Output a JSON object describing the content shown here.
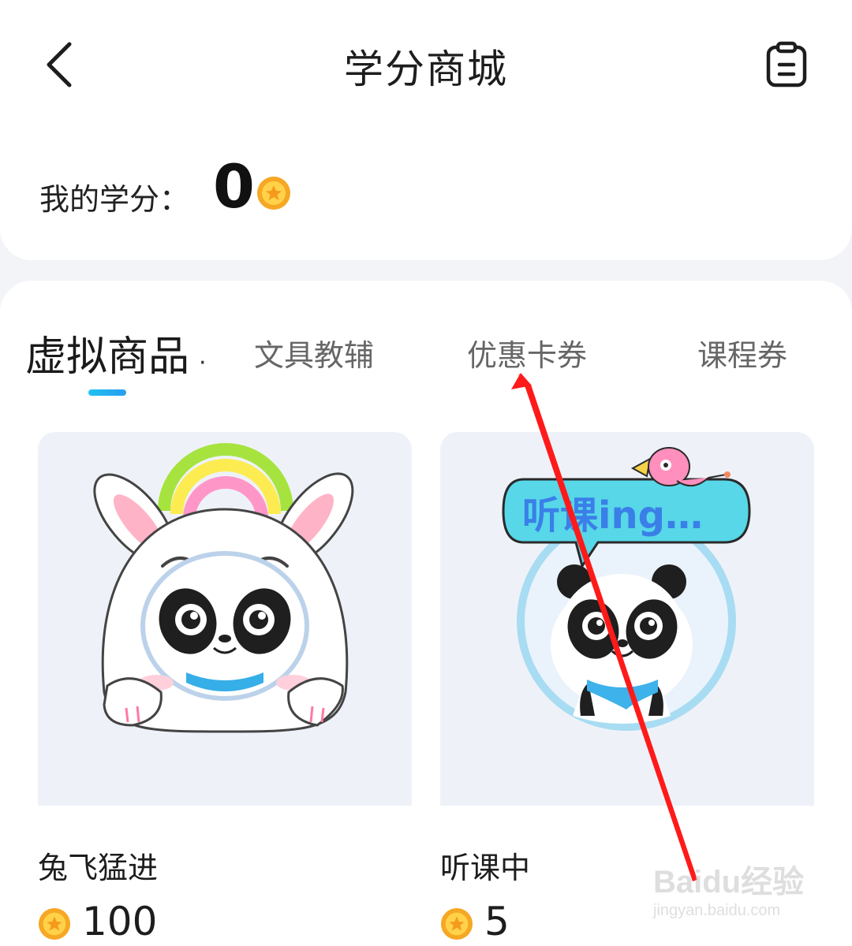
{
  "header": {
    "title": "学分商城",
    "back_icon": "chevron-left-icon",
    "orders_icon": "clipboard-icon"
  },
  "credits": {
    "label": "我的学分：",
    "value": "0",
    "coin_icon": "gold-coin-icon"
  },
  "tabs": [
    {
      "label": "虚拟商品",
      "active": true
    },
    {
      "label": "文具教辅",
      "active": false
    },
    {
      "label": "优惠卡券",
      "active": false
    },
    {
      "label": "课程券",
      "active": false
    }
  ],
  "products": [
    {
      "name": "兔飞猛进",
      "price": "100",
      "image_icon": "bunny-panda-avatar-icon"
    },
    {
      "name": "听课中",
      "price": "5",
      "image_icon": "listening-panda-avatar-icon"
    }
  ],
  "overlay": {
    "annotation": "red-arrow-pointing-at-tab",
    "watermark_brand": "Baidu经验",
    "watermark_url": "jingyan.baidu.com"
  },
  "colors": {
    "accent": "#22b4ef",
    "coin": "#f8b92b",
    "annotation": "#ff1a1a"
  }
}
